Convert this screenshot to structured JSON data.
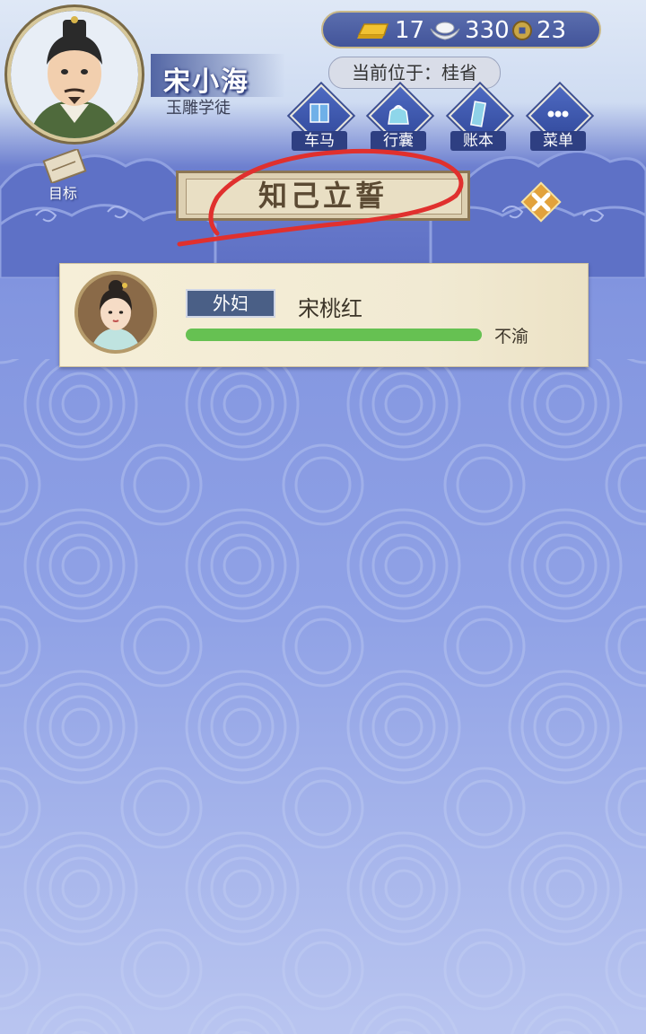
{
  "header": {
    "player_name": "宋小海",
    "player_title": "玉雕学徒",
    "location": "当前位于：桂省"
  },
  "currency": {
    "gold": "17",
    "silver": "330",
    "coin": "23"
  },
  "menu": [
    {
      "label": "车马",
      "icon": "carriage-icon"
    },
    {
      "label": "行囊",
      "icon": "bag-icon"
    },
    {
      "label": "账本",
      "icon": "ledger-icon"
    },
    {
      "label": "菜单",
      "icon": "more-icon"
    }
  ],
  "goal": {
    "label": "目标"
  },
  "panel": {
    "title": "知己立誓"
  },
  "characters": [
    {
      "relation": "外妇",
      "name": "宋桃红",
      "mood": "不渝",
      "affection_fraction": 1.0
    }
  ],
  "colors": {
    "affection_bar": "#66c152",
    "annotation": "#e0302e"
  }
}
